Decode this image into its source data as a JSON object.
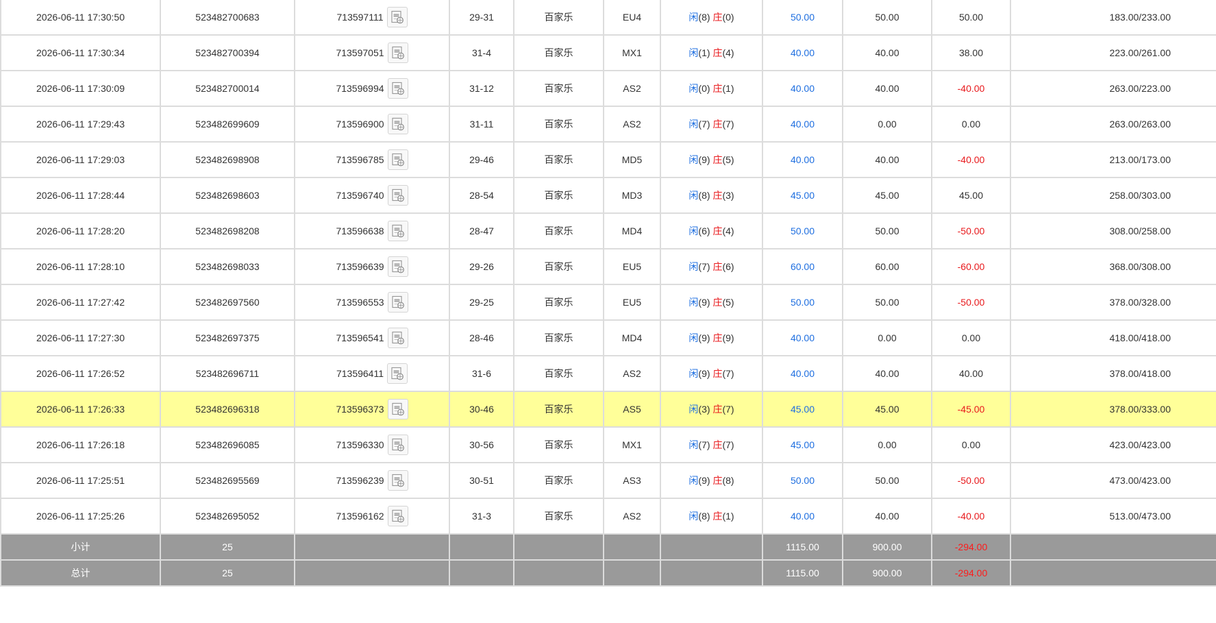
{
  "rows": [
    {
      "time": "2026-06-11 17:30:50",
      "order_no": "523482700683",
      "round_no": "713597111",
      "shoe": "29-31",
      "game": "百家乐",
      "table": "EU4",
      "player_label": "闲",
      "player_val": "(8)",
      "banker_label": "庄",
      "banker_val": "(0)",
      "bet": "50.00",
      "valid_bet": "50.00",
      "win_loss": "50.00",
      "win_negative": false,
      "balance": "183.00/233.00",
      "highlight": false
    },
    {
      "time": "2026-06-11 17:30:34",
      "order_no": "523482700394",
      "round_no": "713597051",
      "shoe": "31-4",
      "game": "百家乐",
      "table": "MX1",
      "player_label": "闲",
      "player_val": "(1)",
      "banker_label": "庄",
      "banker_val": "(4)",
      "bet": "40.00",
      "valid_bet": "40.00",
      "win_loss": "38.00",
      "win_negative": false,
      "balance": "223.00/261.00",
      "highlight": false
    },
    {
      "time": "2026-06-11 17:30:09",
      "order_no": "523482700014",
      "round_no": "713596994",
      "shoe": "31-12",
      "game": "百家乐",
      "table": "AS2",
      "player_label": "闲",
      "player_val": "(0)",
      "banker_label": "庄",
      "banker_val": "(1)",
      "bet": "40.00",
      "valid_bet": "40.00",
      "win_loss": "-40.00",
      "win_negative": true,
      "balance": "263.00/223.00",
      "highlight": false
    },
    {
      "time": "2026-06-11 17:29:43",
      "order_no": "523482699609",
      "round_no": "713596900",
      "shoe": "31-11",
      "game": "百家乐",
      "table": "AS2",
      "player_label": "闲",
      "player_val": "(7)",
      "banker_label": "庄",
      "banker_val": "(7)",
      "bet": "40.00",
      "valid_bet": "0.00",
      "win_loss": "0.00",
      "win_negative": false,
      "balance": "263.00/263.00",
      "highlight": false
    },
    {
      "time": "2026-06-11 17:29:03",
      "order_no": "523482698908",
      "round_no": "713596785",
      "shoe": "29-46",
      "game": "百家乐",
      "table": "MD5",
      "player_label": "闲",
      "player_val": "(9)",
      "banker_label": "庄",
      "banker_val": "(5)",
      "bet": "40.00",
      "valid_bet": "40.00",
      "win_loss": "-40.00",
      "win_negative": true,
      "balance": "213.00/173.00",
      "highlight": false
    },
    {
      "time": "2026-06-11 17:28:44",
      "order_no": "523482698603",
      "round_no": "713596740",
      "shoe": "28-54",
      "game": "百家乐",
      "table": "MD3",
      "player_label": "闲",
      "player_val": "(8)",
      "banker_label": "庄",
      "banker_val": "(3)",
      "bet": "45.00",
      "valid_bet": "45.00",
      "win_loss": "45.00",
      "win_negative": false,
      "balance": "258.00/303.00",
      "highlight": false
    },
    {
      "time": "2026-06-11 17:28:20",
      "order_no": "523482698208",
      "round_no": "713596638",
      "shoe": "28-47",
      "game": "百家乐",
      "table": "MD4",
      "player_label": "闲",
      "player_val": "(6)",
      "banker_label": "庄",
      "banker_val": "(4)",
      "bet": "50.00",
      "valid_bet": "50.00",
      "win_loss": "-50.00",
      "win_negative": true,
      "balance": "308.00/258.00",
      "highlight": false
    },
    {
      "time": "2026-06-11 17:28:10",
      "order_no": "523482698033",
      "round_no": "713596639",
      "shoe": "29-26",
      "game": "百家乐",
      "table": "EU5",
      "player_label": "闲",
      "player_val": "(7)",
      "banker_label": "庄",
      "banker_val": "(6)",
      "bet": "60.00",
      "valid_bet": "60.00",
      "win_loss": "-60.00",
      "win_negative": true,
      "balance": "368.00/308.00",
      "highlight": false
    },
    {
      "time": "2026-06-11 17:27:42",
      "order_no": "523482697560",
      "round_no": "713596553",
      "shoe": "29-25",
      "game": "百家乐",
      "table": "EU5",
      "player_label": "闲",
      "player_val": "(9)",
      "banker_label": "庄",
      "banker_val": "(5)",
      "bet": "50.00",
      "valid_bet": "50.00",
      "win_loss": "-50.00",
      "win_negative": true,
      "balance": "378.00/328.00",
      "highlight": false
    },
    {
      "time": "2026-06-11 17:27:30",
      "order_no": "523482697375",
      "round_no": "713596541",
      "shoe": "28-46",
      "game": "百家乐",
      "table": "MD4",
      "player_label": "闲",
      "player_val": "(9)",
      "banker_label": "庄",
      "banker_val": "(9)",
      "bet": "40.00",
      "valid_bet": "0.00",
      "win_loss": "0.00",
      "win_negative": false,
      "balance": "418.00/418.00",
      "highlight": false
    },
    {
      "time": "2026-06-11 17:26:52",
      "order_no": "523482696711",
      "round_no": "713596411",
      "shoe": "31-6",
      "game": "百家乐",
      "table": "AS2",
      "player_label": "闲",
      "player_val": "(9)",
      "banker_label": "庄",
      "banker_val": "(7)",
      "bet": "40.00",
      "valid_bet": "40.00",
      "win_loss": "40.00",
      "win_negative": false,
      "balance": "378.00/418.00",
      "highlight": false
    },
    {
      "time": "2026-06-11 17:26:33",
      "order_no": "523482696318",
      "round_no": "713596373",
      "shoe": "30-46",
      "game": "百家乐",
      "table": "AS5",
      "player_label": "闲",
      "player_val": "(3)",
      "banker_label": "庄",
      "banker_val": "(7)",
      "bet": "45.00",
      "valid_bet": "45.00",
      "win_loss": "-45.00",
      "win_negative": true,
      "balance": "378.00/333.00",
      "highlight": true
    },
    {
      "time": "2026-06-11 17:26:18",
      "order_no": "523482696085",
      "round_no": "713596330",
      "shoe": "30-56",
      "game": "百家乐",
      "table": "MX1",
      "player_label": "闲",
      "player_val": "(7)",
      "banker_label": "庄",
      "banker_val": "(7)",
      "bet": "45.00",
      "valid_bet": "0.00",
      "win_loss": "0.00",
      "win_negative": false,
      "balance": "423.00/423.00",
      "highlight": false
    },
    {
      "time": "2026-06-11 17:25:51",
      "order_no": "523482695569",
      "round_no": "713596239",
      "shoe": "30-51",
      "game": "百家乐",
      "table": "AS3",
      "player_label": "闲",
      "player_val": "(9)",
      "banker_label": "庄",
      "banker_val": "(8)",
      "bet": "50.00",
      "valid_bet": "50.00",
      "win_loss": "-50.00",
      "win_negative": true,
      "balance": "473.00/423.00",
      "highlight": false
    },
    {
      "time": "2026-06-11 17:25:26",
      "order_no": "523482695052",
      "round_no": "713596162",
      "shoe": "31-3",
      "game": "百家乐",
      "table": "AS2",
      "player_label": "闲",
      "player_val": "(8)",
      "banker_label": "庄",
      "banker_val": "(1)",
      "bet": "40.00",
      "valid_bet": "40.00",
      "win_loss": "-40.00",
      "win_negative": true,
      "balance": "513.00/473.00",
      "highlight": false
    }
  ],
  "subtotal": {
    "label": "小计",
    "count": "25",
    "bet": "1115.00",
    "valid_bet": "900.00",
    "win_loss": "-294.00"
  },
  "total": {
    "label": "总计",
    "count": "25",
    "bet": "1115.00",
    "valid_bet": "900.00",
    "win_loss": "-294.00"
  },
  "icons": {
    "record": "video-replay-icon"
  },
  "colors": {
    "player": "#1f6fe0",
    "banker": "#e8191c",
    "negative": "#e8191c",
    "highlight_row": "#ffff99",
    "summary_bg": "#9a9a9a",
    "border": "#dcdcdc"
  }
}
